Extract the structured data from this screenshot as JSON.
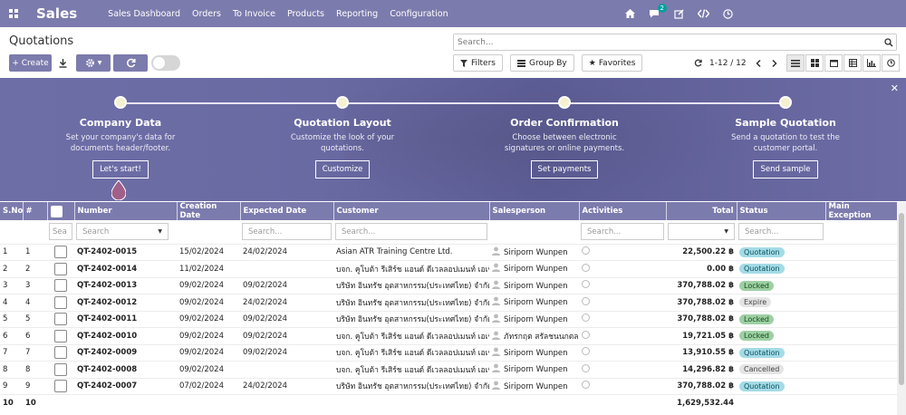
{
  "navbar": {
    "brand": "Sales",
    "menu": [
      "Sales Dashboard",
      "Orders",
      "To Invoice",
      "Products",
      "Reporting",
      "Configuration"
    ],
    "chat_badge": "2"
  },
  "control": {
    "breadcrumb": "Quotations",
    "search_placeholder": "Search...",
    "create_label": "Create",
    "filters_label": "Filters",
    "groupby_label": "Group By",
    "favorites_label": "Favorites",
    "pager": "1-12 / 12"
  },
  "banner": {
    "steps": [
      {
        "title": "Company Data",
        "desc": "Set your company's data for documents header/footer.",
        "button": "Let's start!"
      },
      {
        "title": "Quotation Layout",
        "desc": "Customize the look of your quotations.",
        "button": "Customize"
      },
      {
        "title": "Order Confirmation",
        "desc": "Choose between electronic signatures or online payments.",
        "button": "Set payments"
      },
      {
        "title": "Sample Quotation",
        "desc": "Send a quotation to test the customer portal.",
        "button": "Send sample"
      }
    ]
  },
  "table": {
    "headers": [
      "S.No",
      "#",
      "",
      "Number",
      "Creation Date",
      "Expected Date",
      "Customer",
      "Salesperson",
      "Activities",
      "Total",
      "Status",
      "Main Exception"
    ],
    "search": {
      "sno": "Sea",
      "number": "Search",
      "expected": "Search...",
      "customer": "Search...",
      "activities": "Search...",
      "status": "Search..."
    },
    "rows": [
      {
        "sno": "1",
        "idx": "1",
        "number": "QT-2402-0015",
        "created": "15/02/2024",
        "expected": "24/02/2024",
        "customer": "Asian ATR Training Centre Ltd.",
        "salesperson": "Siriporn Wunpen",
        "total": "22,500.22 ฿",
        "status": "Quotation",
        "st": "quotation"
      },
      {
        "sno": "2",
        "idx": "2",
        "number": "QT-2402-0014",
        "created": "11/02/2024",
        "expected": "",
        "customer": "บจก. คูโบต้า รีเสิร์ช แอนด์ ดีเวลลอปเมนท์ เอเชีย",
        "salesperson": "Siriporn Wunpen",
        "total": "0.00 ฿",
        "status": "Quotation",
        "st": "quotation"
      },
      {
        "sno": "3",
        "idx": "3",
        "number": "QT-2402-0013",
        "created": "09/02/2024",
        "expected": "09/02/2024",
        "customer": "บริษัท อินทรัช อุตสาหกรรม(ประเทศไทย) จำกัด",
        "salesperson": "Siriporn Wunpen",
        "total": "370,788.02 ฿",
        "status": "Locked",
        "st": "locked"
      },
      {
        "sno": "4",
        "idx": "4",
        "number": "QT-2402-0012",
        "created": "09/02/2024",
        "expected": "24/02/2024",
        "customer": "บริษัท อินทรัช อุตสาหกรรม(ประเทศไทย) จำกัด",
        "salesperson": "Siriporn Wunpen",
        "total": "370,788.02 ฿",
        "status": "Expire",
        "st": "expire"
      },
      {
        "sno": "5",
        "idx": "5",
        "number": "QT-2402-0011",
        "created": "09/02/2024",
        "expected": "09/02/2024",
        "customer": "บริษัท อินทรัช อุตสาหกรรม(ประเทศไทย) จำกัด",
        "salesperson": "Siriporn Wunpen",
        "total": "370,788.02 ฿",
        "status": "Locked",
        "st": "locked"
      },
      {
        "sno": "6",
        "idx": "6",
        "number": "QT-2402-0010",
        "created": "09/02/2024",
        "expected": "09/02/2024",
        "customer": "บจก. คูโบต้า รีเสิร์ช แอนด์ ดีเวลลอปเมนท์ เอเชีย",
        "salesperson": "ภัทรกฤต สรัลชนนกตล",
        "total": "19,721.05 ฿",
        "status": "Locked",
        "st": "locked"
      },
      {
        "sno": "7",
        "idx": "7",
        "number": "QT-2402-0009",
        "created": "09/02/2024",
        "expected": "09/02/2024",
        "customer": "บจก. คูโบต้า รีเสิร์ช แอนด์ ดีเวลลอปเมนท์ เอเชีย",
        "salesperson": "Siriporn Wunpen",
        "total": "13,910.55 ฿",
        "status": "Quotation",
        "st": "quotation"
      },
      {
        "sno": "8",
        "idx": "8",
        "number": "QT-2402-0008",
        "created": "09/02/2024",
        "expected": "",
        "customer": "บจก. คูโบต้า รีเสิร์ช แอนด์ ดีเวลลอปเมนท์ เอเชีย",
        "salesperson": "Siriporn Wunpen",
        "total": "14,296.82 ฿",
        "status": "Cancelled",
        "st": "cancelled"
      },
      {
        "sno": "9",
        "idx": "9",
        "number": "QT-2402-0007",
        "created": "07/02/2024",
        "expected": "24/02/2024",
        "customer": "บริษัท อินทรัช อุตสาหกรรม(ประเทศไทย) จำกัด",
        "salesperson": "Siriporn Wunpen",
        "total": "370,788.02 ฿",
        "status": "Quotation",
        "st": "quotation"
      }
    ],
    "last_row": {
      "sno": "10",
      "idx": "10"
    },
    "grand_total": "1,629,532.44"
  }
}
